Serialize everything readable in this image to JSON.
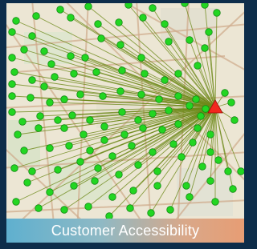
{
  "caption": "Customer Accessibility",
  "colors": {
    "frame": "#0d2d4a",
    "map_base": "#ece6d4",
    "road": "#cfa98a",
    "customer": "#22d622",
    "customer_stroke": "#148a14",
    "line": "#6e8a1a",
    "facility": "#f2281e"
  },
  "icons": {
    "customer": "green-circle",
    "facility": "red-triangle"
  }
}
